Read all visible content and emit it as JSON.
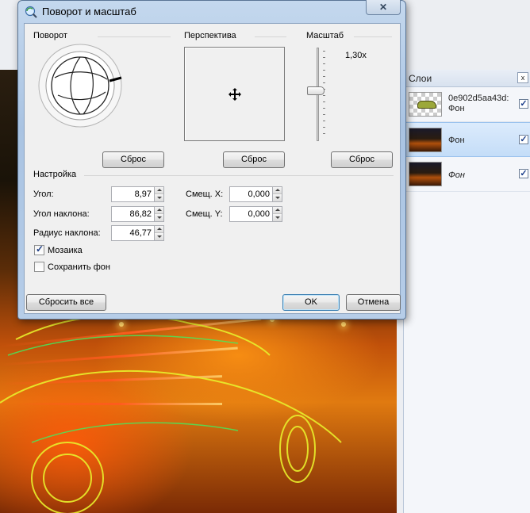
{
  "dialog": {
    "title": "Поворот и масштаб",
    "close_label": "✕",
    "sections": {
      "rotation": "Поворот",
      "perspective": "Перспектива",
      "scale": "Масштаб",
      "settings": "Настройка"
    },
    "scale_value": "1,30x",
    "reset_label": "Сброс",
    "fields": {
      "angle": {
        "label": "Угол:",
        "value": "8,97"
      },
      "tilt_angle": {
        "label": "Угол наклона:",
        "value": "86,82"
      },
      "tilt_radius": {
        "label": "Радиус наклона:",
        "value": "46,77"
      },
      "offset_x": {
        "label": "Смещ. X:",
        "value": "0,000"
      },
      "offset_y": {
        "label": "Смещ. Y:",
        "value": "0,000"
      }
    },
    "checkboxes": {
      "tiling": {
        "label": "Мозаика",
        "checked": true
      },
      "keep_background": {
        "label": "Сохранить фон",
        "checked": false
      }
    },
    "buttons": {
      "reset_all": "Сбросить все",
      "ok": "OK",
      "cancel": "Отмена"
    }
  },
  "layers_panel": {
    "title": "Слои",
    "close_label": "x",
    "layers": [
      {
        "name_line1": "0e902d5aa43d:",
        "name_line2": "Фон",
        "visible": true,
        "selected": false,
        "thumb": "checker-car"
      },
      {
        "name": "Фон",
        "visible": true,
        "selected": true,
        "thumb": "night-road"
      },
      {
        "name": "Фон",
        "visible": true,
        "selected": false,
        "thumb": "night-road"
      }
    ]
  },
  "colors": {
    "title_gradient": "#a9c3e2",
    "selection": "#c4ddf8",
    "default_button_border": "#3c7fb1"
  }
}
